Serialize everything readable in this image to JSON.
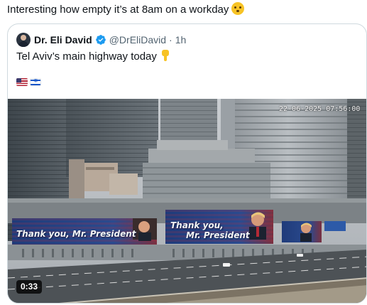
{
  "post": {
    "text": "Interesting how empty it’s at 8am on a workday",
    "emoji": "face-with-hand-over-mouth"
  },
  "quoted": {
    "author_name": "Dr. Eli David",
    "handle": "@DrEliDavid",
    "separator": "·",
    "time": "1h",
    "text": "Tel Aviv’s main highway today",
    "text_emoji": "backhand-index-pointing-down",
    "flags": [
      "flag-us",
      "flag-israel"
    ],
    "verified_color": "#1d9bf0"
  },
  "video": {
    "camera_timestamp": "22-06-2025 07:56:00",
    "billboard_left_text": "Thank you, Mr. President",
    "billboard_center_line1": "Thank you,",
    "billboard_center_line2": "Mr. President",
    "duration": "0:33"
  }
}
